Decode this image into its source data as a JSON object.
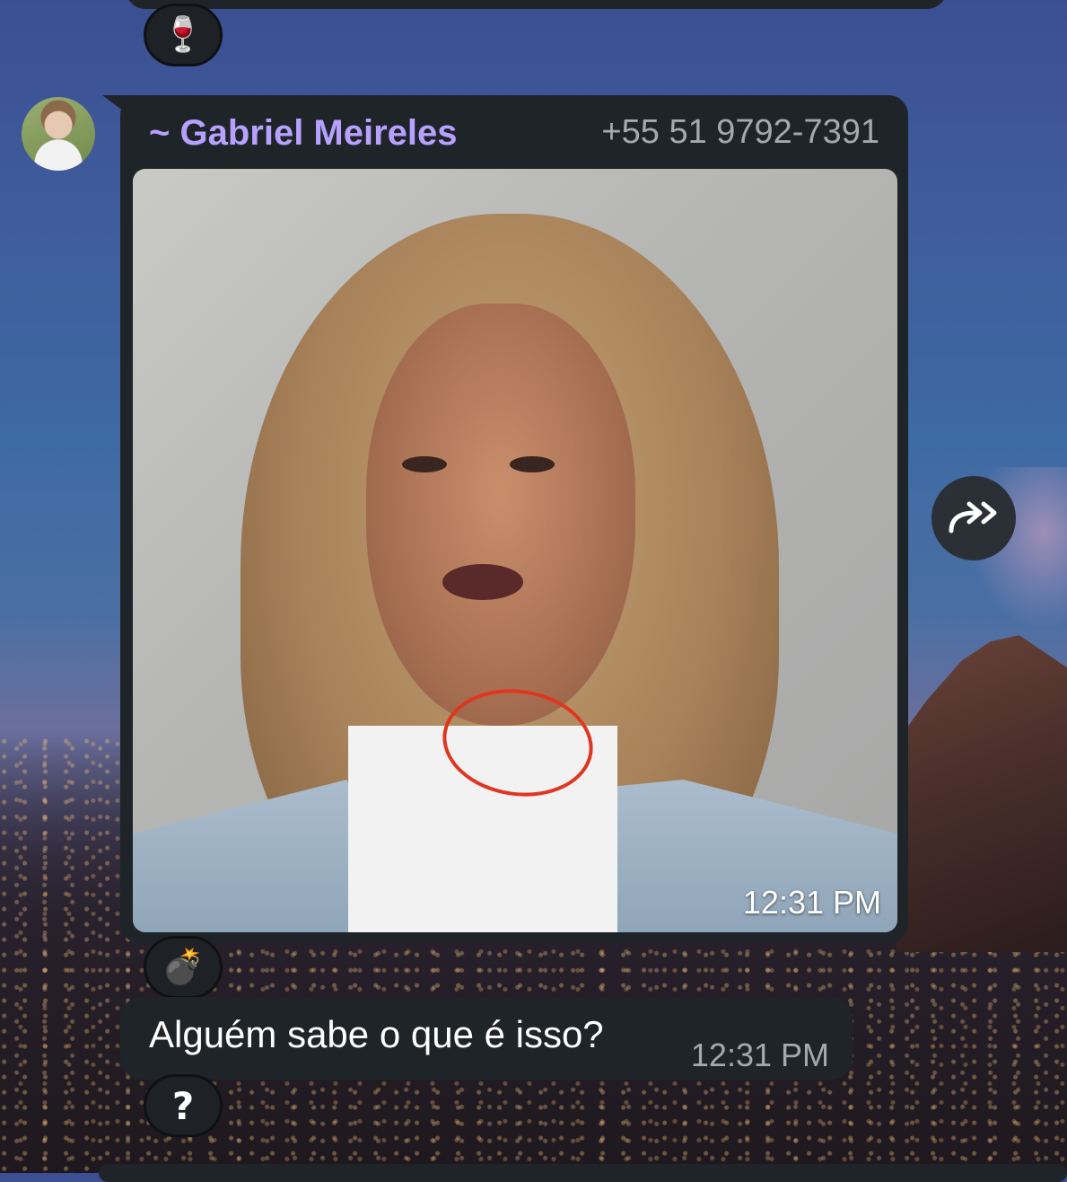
{
  "reactions": {
    "top": "🍷",
    "media": "💣",
    "text": "?"
  },
  "message_media": {
    "sender_name": "~ Gabriel Meireles",
    "sender_phone": "+55 51 9792-7391",
    "time": "12:31 PM"
  },
  "message_text": {
    "text": "Alguém sabe o que é isso?",
    "time": "12:31 PM"
  },
  "icons": {
    "forward": "forward-icon",
    "avatar": "avatar"
  },
  "colors": {
    "bubble": "#1f2428",
    "sender_name": "#b6a1ff",
    "meta_text": "#a4a9ad",
    "annotation_circle": "#e0351f"
  }
}
